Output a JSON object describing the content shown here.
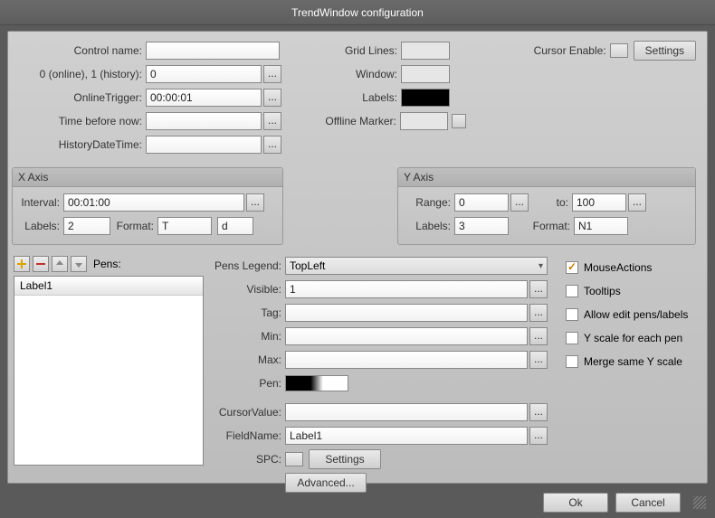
{
  "title": "TrendWindow configuration",
  "left": {
    "control_name": {
      "label": "Control name:",
      "value": ""
    },
    "online_history": {
      "label": "0 (online), 1 (history):",
      "value": "0"
    },
    "online_trigger": {
      "label": "OnlineTrigger:",
      "value": "00:00:01"
    },
    "time_before_now": {
      "label": "Time before now:",
      "value": ""
    },
    "history_datetime": {
      "label": "HistoryDateTime:",
      "value": ""
    }
  },
  "mid": {
    "grid_lines": "Grid Lines:",
    "window": "Window:",
    "labels": "Labels:",
    "offline_marker": "Offline Marker:"
  },
  "cursor": {
    "enable_label": "Cursor Enable:",
    "settings": "Settings"
  },
  "xaxis": {
    "title": "X Axis",
    "interval_label": "Interval:",
    "interval": "00:01:00",
    "labels_label": "Labels:",
    "labels": "2",
    "format_label": "Format:",
    "format1": "T",
    "format2": "d"
  },
  "yaxis": {
    "title": "Y Axis",
    "range_label": "Range:",
    "from": "0",
    "to_label": "to:",
    "to": "100",
    "labels_label": "Labels:",
    "labels": "3",
    "format_label": "Format:",
    "format": "N1"
  },
  "pens": {
    "toolbar_label": "Pens:",
    "list": [
      "Label1"
    ],
    "legend_label": "Pens Legend:",
    "legend_value": "TopLeft",
    "visible_label": "Visible:",
    "visible": "1",
    "tag_label": "Tag:",
    "tag": "",
    "min_label": "Min:",
    "min": "",
    "max_label": "Max:",
    "max": "",
    "pen_label": "Pen:",
    "cursor_value_label": "CursorValue:",
    "cursor_value": "",
    "field_name_label": "FieldName:",
    "field_name": "Label1",
    "spc_label": "SPC:",
    "spc_settings": "Settings",
    "advanced": "Advanced..."
  },
  "checks": {
    "mouse_actions": "MouseActions",
    "tooltips": "Tooltips",
    "allow_edit": "Allow edit pens/labels",
    "y_each": "Y scale for each pen",
    "merge": "Merge same Y scale"
  },
  "buttons": {
    "ok": "Ok",
    "cancel": "Cancel"
  },
  "ellipsis": "..."
}
